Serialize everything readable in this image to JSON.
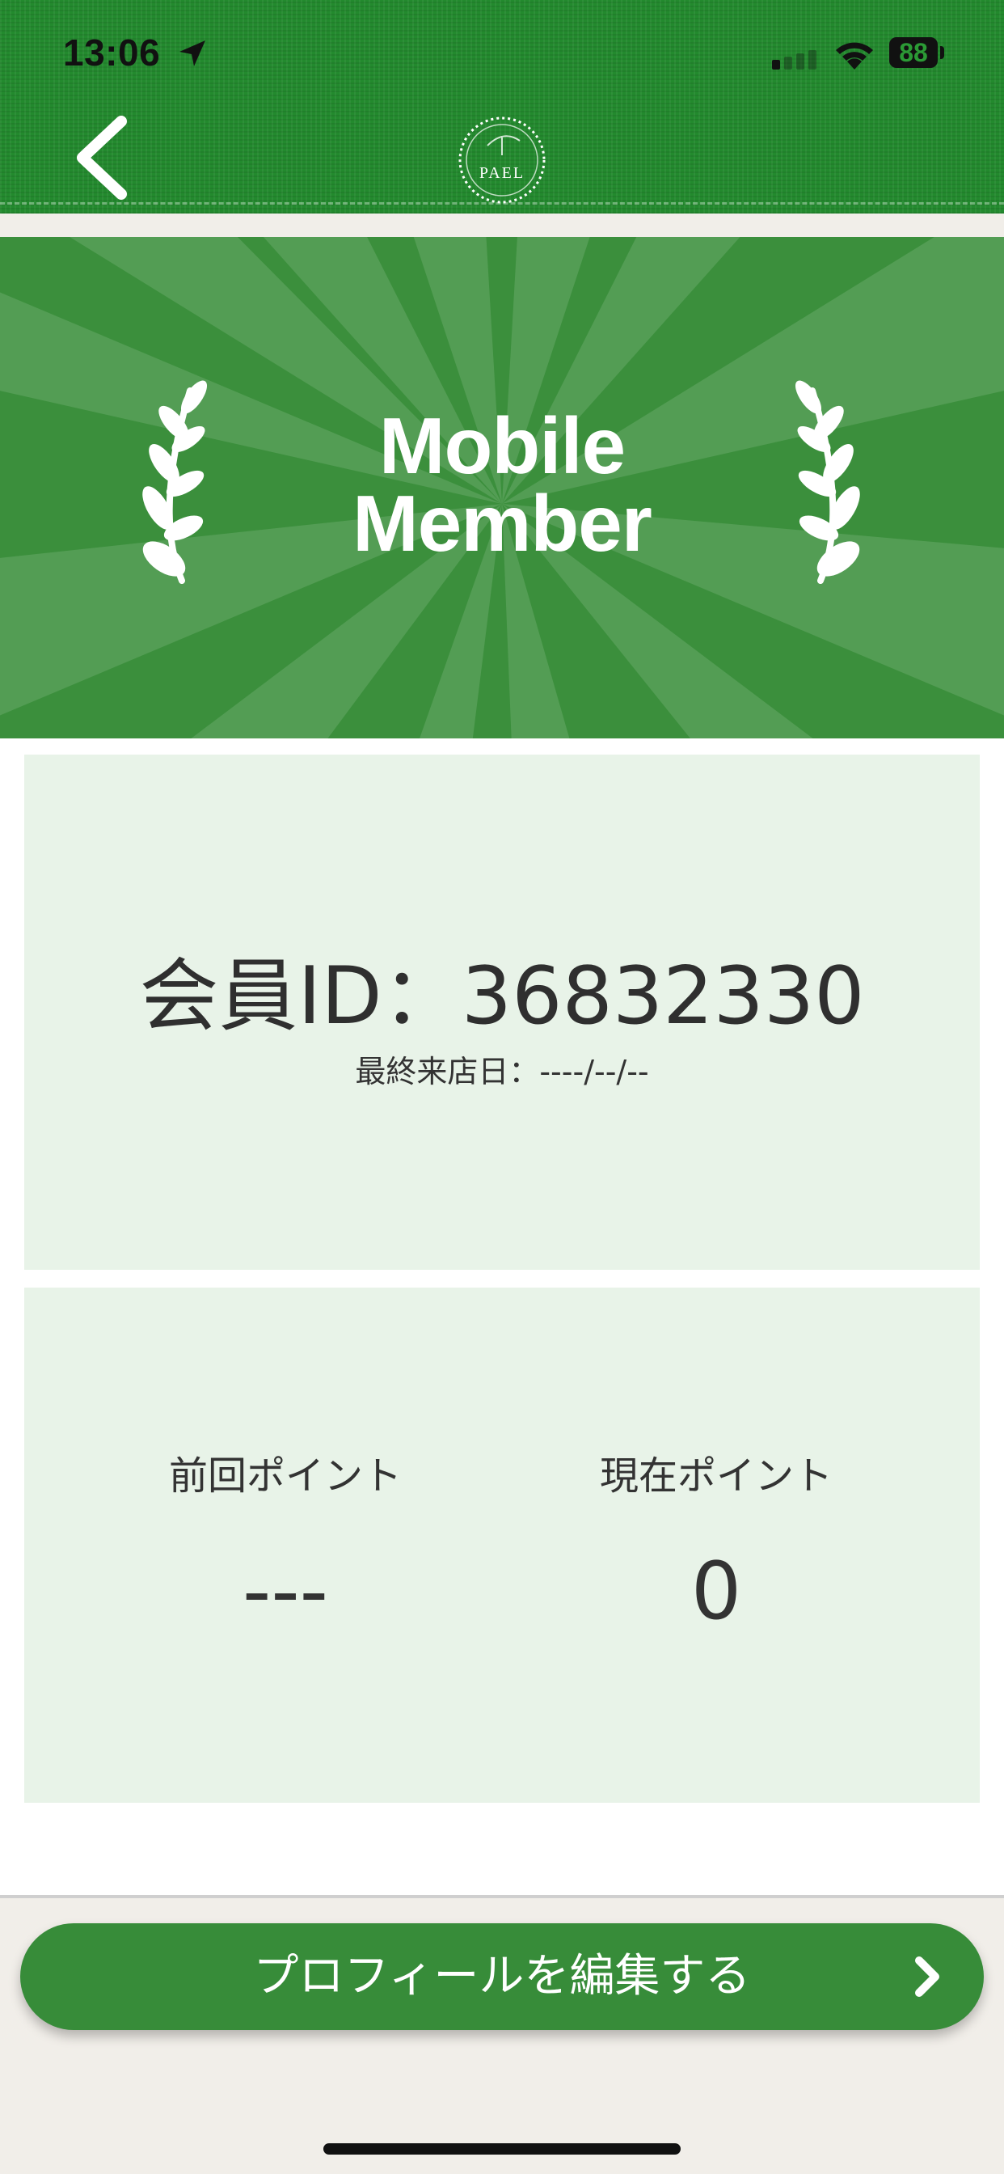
{
  "status_bar": {
    "time": "13:06",
    "battery": "88"
  },
  "nav": {
    "logo_text": "PAEL"
  },
  "banner": {
    "title_line1": "Mobile",
    "title_line2": "Member"
  },
  "member": {
    "id_label": "会員ID：36832330",
    "last_visit": "最終来店日：----/--/--"
  },
  "points": {
    "previous_label": "前回ポイント",
    "previous_value": "---",
    "current_label": "現在ポイント",
    "current_value": "0"
  },
  "actions": {
    "edit_profile_label": "プロフィールを編集する"
  },
  "colors": {
    "header_green": "#238a2e",
    "banner_green": "#3b8f3c",
    "card_tint": "#e8f3e8",
    "button_green": "#378c39"
  },
  "icons": [
    "location-arrow-icon",
    "signal-icon",
    "wifi-icon",
    "battery-icon",
    "back-chevron-icon",
    "laurel-icon",
    "chevron-right-icon"
  ]
}
